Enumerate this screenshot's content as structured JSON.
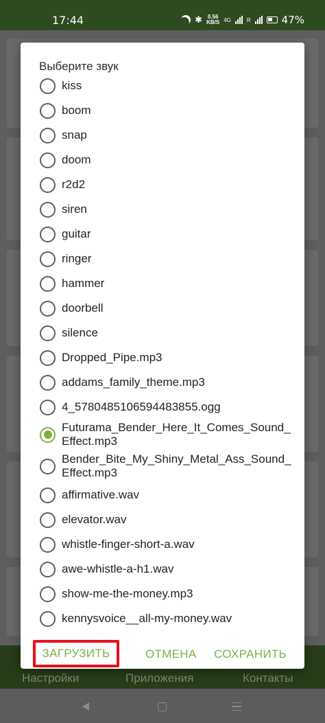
{
  "status_bar": {
    "time": "17:44",
    "network_speed_value": "0.56",
    "network_speed_unit": "KB/S",
    "network_type": "4G",
    "roaming": "R",
    "battery_percent": "47%"
  },
  "background_nav": {
    "items": [
      "Настройки",
      "Приложения",
      "Контакты"
    ]
  },
  "dialog": {
    "title": "Выберите звук",
    "options": [
      {
        "label": "kiss",
        "selected": false
      },
      {
        "label": "boom",
        "selected": false
      },
      {
        "label": "snap",
        "selected": false
      },
      {
        "label": "doom",
        "selected": false
      },
      {
        "label": "r2d2",
        "selected": false
      },
      {
        "label": "siren",
        "selected": false
      },
      {
        "label": "guitar",
        "selected": false
      },
      {
        "label": "ringer",
        "selected": false
      },
      {
        "label": "hammer",
        "selected": false
      },
      {
        "label": "doorbell",
        "selected": false
      },
      {
        "label": "silence",
        "selected": false
      },
      {
        "label": "Dropped_Pipe.mp3",
        "selected": false
      },
      {
        "label": "addams_family_theme.mp3",
        "selected": false
      },
      {
        "label": "4_5780485106594483855.ogg",
        "selected": false
      },
      {
        "label": "Futurama_Bender_Here_It_Comes_Sound_Effect.mp3",
        "selected": true
      },
      {
        "label": "Bender_Bite_My_Shiny_Metal_Ass_Sound_Effect.mp3",
        "selected": false
      },
      {
        "label": "affirmative.wav",
        "selected": false
      },
      {
        "label": "elevator.wav",
        "selected": false
      },
      {
        "label": "whistle-finger-short-a.wav",
        "selected": false
      },
      {
        "label": "awe-whistle-a-h1.wav",
        "selected": false
      },
      {
        "label": "show-me-the-money.mp3",
        "selected": false
      },
      {
        "label": "kennysvoice__all-my-money.wav",
        "selected": false
      }
    ],
    "buttons": {
      "load": "ЗАГРУЗИТЬ",
      "cancel": "ОТМЕНА",
      "save": "СОХРАНИТЬ"
    }
  },
  "colors": {
    "accent": "#7cb043",
    "status_bar_bg": "#2e4a1f",
    "highlight_box": "#e8101e"
  }
}
